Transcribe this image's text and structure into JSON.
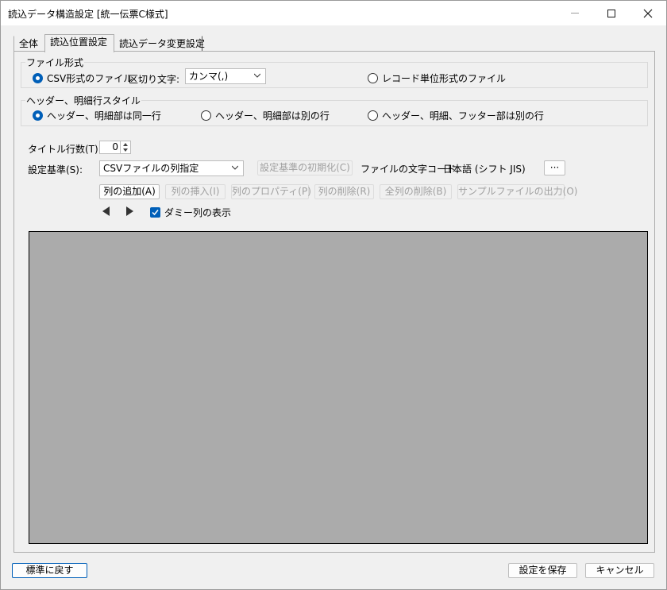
{
  "window": {
    "title": "読込データ構造設定 [統一伝票C様式]"
  },
  "tabs": [
    {
      "label": "全体"
    },
    {
      "label": "読込位置設定"
    },
    {
      "label": "読込データ変更設定"
    }
  ],
  "file_format": {
    "group_title": "ファイル形式",
    "csv_label": "CSV形式のファイル",
    "delimiter_label": "区切り文字:",
    "delimiter_value": "カンマ(,)",
    "record_label": "レコード単位形式のファイル"
  },
  "header_style": {
    "group_title": "ヘッダー、明細行スタイル",
    "option1": "ヘッダー、明細部は同一行",
    "option2": "ヘッダー、明細部は別の行",
    "option3": "ヘッダー、明細、フッター部は別の行"
  },
  "title_rows": {
    "label": "タイトル行数(T):",
    "value": "0"
  },
  "settings_basis": {
    "label": "設定基準(S):",
    "value": "CSVファイルの列指定",
    "init_button": "設定基準の初期化(C)",
    "encoding_label": "ファイルの文字コード:",
    "encoding_value": "日本語 (シフト JIS)",
    "more_button": "···"
  },
  "column_buttons": {
    "add": "列の追加(A)",
    "insert": "列の挿入(I)",
    "properties": "列のプロパティ(P)",
    "delete": "列の削除(R)",
    "delete_all": "全列の削除(B)",
    "sample_output": "サンプルファイルの出力(O)"
  },
  "dummy_columns": {
    "label": "ダミー列の表示",
    "checked": true
  },
  "footer": {
    "reset": "標準に戻す",
    "save": "設定を保存",
    "cancel": "キャンセル"
  },
  "colors": {
    "accent": "#005fb8",
    "grid_background": "#ababab"
  }
}
